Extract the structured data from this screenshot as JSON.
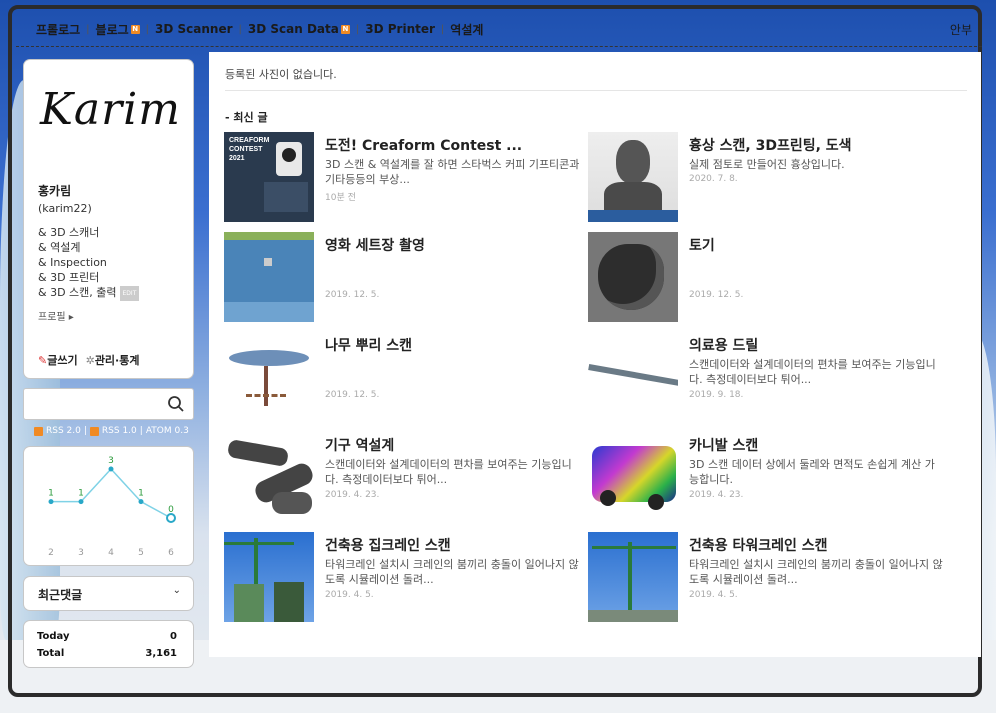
{
  "nav": {
    "items": [
      {
        "label": "프롤로그",
        "new": false
      },
      {
        "label": "블로그",
        "new": true
      },
      {
        "label": "3D Scanner",
        "new": false
      },
      {
        "label": "3D Scan Data",
        "new": true
      },
      {
        "label": "3D Printer",
        "new": false
      },
      {
        "label": "역설계",
        "new": false
      }
    ],
    "new_badge": "N",
    "right_label": "안부"
  },
  "profile": {
    "logo_text": "Karim",
    "name": "홍카림",
    "id": "(karim22)",
    "tags": [
      "& 3D 스캐너",
      "& 역설계",
      "& Inspection",
      "& 3D 프린터",
      "& 3D 스캔, 출력"
    ],
    "edit_label": "EDIT",
    "profile_link": "프로필",
    "write_label": "글쓰기",
    "manage_label": "관리·통계"
  },
  "search": {
    "placeholder": ""
  },
  "feeds": [
    "RSS 2.0",
    "RSS 1.0",
    "ATOM 0.3"
  ],
  "chart_data": {
    "type": "line",
    "x": [
      "2",
      "3",
      "4",
      "5",
      "6"
    ],
    "values": [
      1,
      1,
      3,
      1,
      0
    ],
    "ylim": [
      0,
      3
    ]
  },
  "recent_comments_label": "최근댓글",
  "stats": {
    "today_label": "Today",
    "today_value": "0",
    "total_label": "Total",
    "total_value": "3,161"
  },
  "main": {
    "no_photo": "등록된 사진이 없습니다.",
    "section_title": "- 최신 글",
    "posts": [
      {
        "title": "도전! Creaform Contest ...",
        "desc": "3D 스캔 & 역설계를 잘 하면 스타벅스 커피 기프티콘과 기타등등의 부상...",
        "date": "10분 전",
        "thumb": "creaform-contest-thumb"
      },
      {
        "title": "흉상 스캔, 3D프린팅, 도색",
        "desc": "실제 점토로 만들어진 흉상입니다.",
        "date": "2020. 7. 8.",
        "thumb": "bust-thumb"
      },
      {
        "title": "영화 세트장 촬영",
        "desc": "",
        "date": "2019. 12. 5.",
        "thumb": "film-set-thumb"
      },
      {
        "title": "토기",
        "desc": "",
        "date": "2019. 12. 5.",
        "thumb": "pottery-thumb"
      },
      {
        "title": "나무 뿌리 스캔",
        "desc": "",
        "date": "2019. 12. 5.",
        "thumb": "tree-root-thumb"
      },
      {
        "title": "의료용 드릴",
        "desc": "스캔데이터와 설계데이터의 편차를 보여주는 기능입니다. 측정데이터보다 튀어...",
        "date": "2019. 9. 18.",
        "thumb": "medical-drill-thumb"
      },
      {
        "title": "기구 역설계",
        "desc": "스캔데이터와 설계데이터의 편차를 보여주는 기능입니다. 측정데이터보다 튀어...",
        "date": "2019. 4. 23.",
        "thumb": "mechanism-thumb"
      },
      {
        "title": "카니발 스캔",
        "desc": "3D 스캔 데이터 상에서 둘레와 면적도 손쉽게 계산 가능합니다.",
        "date": "2019. 4. 23.",
        "thumb": "carnival-thumb"
      },
      {
        "title": "건축용 집크레인 스캔",
        "desc": "타워크레인 설치시 크레인의 붐끼리 충돌이 일어나지 않도록 시뮬레이션 돌려...",
        "date": "2019. 4. 5.",
        "thumb": "jib-crane-thumb"
      },
      {
        "title": "건축용 타워크레인 스캔",
        "desc": "타워크레인 설치시 크레인의 붐끼리 충돌이 일어나지 않도록 시뮬레이션 돌려...",
        "date": "2019. 4. 5.",
        "thumb": "tower-crane-thumb"
      }
    ],
    "thumb1_text": [
      "CREAFORM",
      "CONTEST",
      "2021"
    ]
  }
}
